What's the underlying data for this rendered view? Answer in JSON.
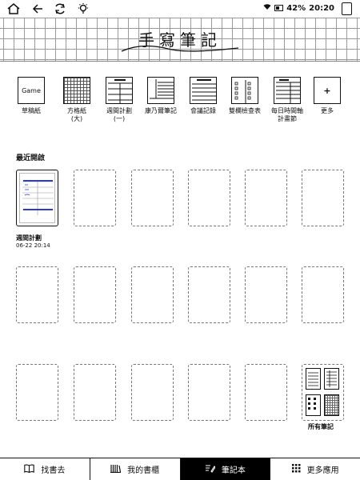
{
  "status": {
    "battery": "42%",
    "time": "20:20"
  },
  "header": {
    "title": "手寫筆記"
  },
  "templates": [
    {
      "label": "草稿紙",
      "thumb": "game",
      "thumb_text": "Game"
    },
    {
      "label": "方格紙\n(大)",
      "thumb": "grid"
    },
    {
      "label": "週間計劃\n(一)",
      "thumb": "weekly"
    },
    {
      "label": "康乃爾筆記",
      "thumb": "cornell"
    },
    {
      "label": "會議記錄",
      "thumb": "meeting"
    },
    {
      "label": "雙欄檢查表",
      "thumb": "checklist"
    },
    {
      "label": "每日時間軸\n計畫節",
      "thumb": "timeline"
    },
    {
      "label": "更多",
      "thumb": "plus",
      "thumb_text": "+"
    }
  ],
  "recent": {
    "label": "最近開啟",
    "first_note": {
      "title": "週間計劃",
      "date": "06-22 20:14"
    }
  },
  "all_notes_label": "所有筆記",
  "nav": [
    {
      "label": "找書去",
      "icon": "book-open-icon",
      "active": false
    },
    {
      "label": "我的書櫃",
      "icon": "bookshelf-icon",
      "active": false
    },
    {
      "label": "筆記本",
      "icon": "notebook-pen-icon",
      "active": true
    },
    {
      "label": "更多應用",
      "icon": "apps-grid-icon",
      "active": false
    }
  ]
}
